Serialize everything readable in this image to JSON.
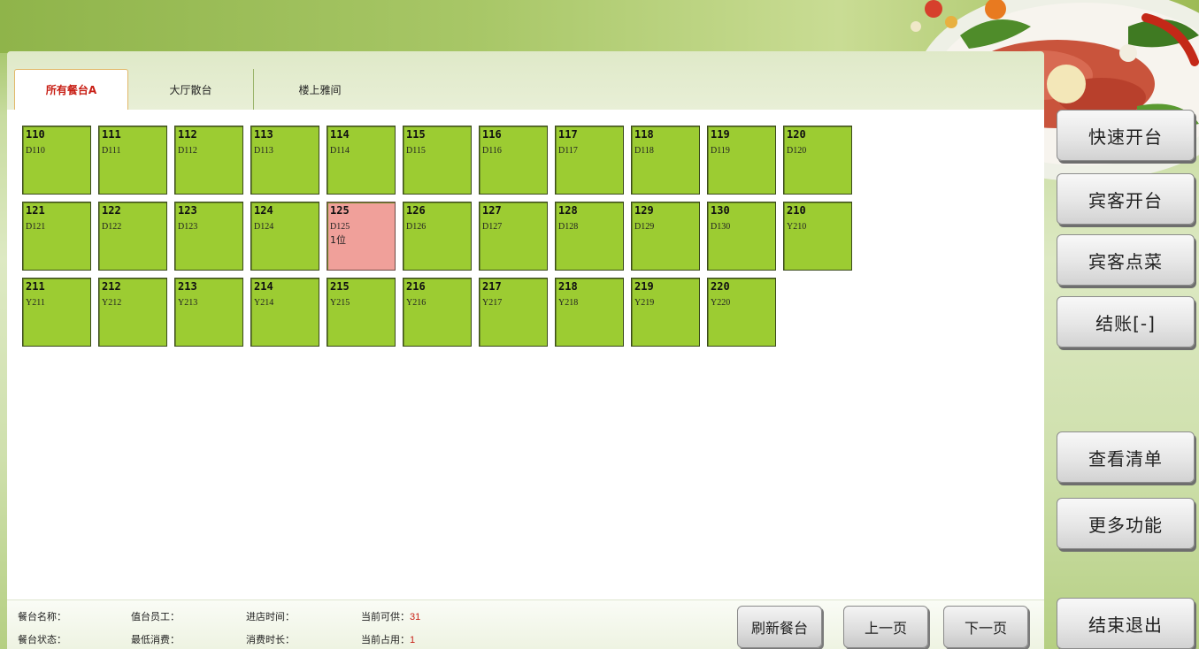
{
  "tabs": [
    {
      "label": "所有餐台A"
    },
    {
      "label": "大厅散台"
    },
    {
      "label": "楼上雅间"
    }
  ],
  "tables": [
    {
      "num": "110",
      "code": "D110",
      "guests": "",
      "status": "free"
    },
    {
      "num": "111",
      "code": "D111",
      "guests": "",
      "status": "free"
    },
    {
      "num": "112",
      "code": "D112",
      "guests": "",
      "status": "free"
    },
    {
      "num": "113",
      "code": "D113",
      "guests": "",
      "status": "free"
    },
    {
      "num": "114",
      "code": "D114",
      "guests": "",
      "status": "free"
    },
    {
      "num": "115",
      "code": "D115",
      "guests": "",
      "status": "free"
    },
    {
      "num": "116",
      "code": "D116",
      "guests": "",
      "status": "free"
    },
    {
      "num": "117",
      "code": "D117",
      "guests": "",
      "status": "free"
    },
    {
      "num": "118",
      "code": "D118",
      "guests": "",
      "status": "free"
    },
    {
      "num": "119",
      "code": "D119",
      "guests": "",
      "status": "free"
    },
    {
      "num": "120",
      "code": "D120",
      "guests": "",
      "status": "free"
    },
    {
      "num": "121",
      "code": "D121",
      "guests": "",
      "status": "free"
    },
    {
      "num": "122",
      "code": "D122",
      "guests": "",
      "status": "free"
    },
    {
      "num": "123",
      "code": "D123",
      "guests": "",
      "status": "free"
    },
    {
      "num": "124",
      "code": "D124",
      "guests": "",
      "status": "free"
    },
    {
      "num": "125",
      "code": "D125",
      "guests": "1位",
      "status": "occupied"
    },
    {
      "num": "126",
      "code": "D126",
      "guests": "",
      "status": "free"
    },
    {
      "num": "127",
      "code": "D127",
      "guests": "",
      "status": "free"
    },
    {
      "num": "128",
      "code": "D128",
      "guests": "",
      "status": "free"
    },
    {
      "num": "129",
      "code": "D129",
      "guests": "",
      "status": "free"
    },
    {
      "num": "130",
      "code": "D130",
      "guests": "",
      "status": "free"
    },
    {
      "num": "210",
      "code": "Y210",
      "guests": "",
      "status": "free"
    },
    {
      "num": "211",
      "code": "Y211",
      "guests": "",
      "status": "free"
    },
    {
      "num": "212",
      "code": "Y212",
      "guests": "",
      "status": "free"
    },
    {
      "num": "213",
      "code": "Y213",
      "guests": "",
      "status": "free"
    },
    {
      "num": "214",
      "code": "Y214",
      "guests": "",
      "status": "free"
    },
    {
      "num": "215",
      "code": "Y215",
      "guests": "",
      "status": "free"
    },
    {
      "num": "216",
      "code": "Y216",
      "guests": "",
      "status": "free"
    },
    {
      "num": "217",
      "code": "Y217",
      "guests": "",
      "status": "free"
    },
    {
      "num": "218",
      "code": "Y218",
      "guests": "",
      "status": "free"
    },
    {
      "num": "219",
      "code": "Y219",
      "guests": "",
      "status": "free"
    },
    {
      "num": "220",
      "code": "Y220",
      "guests": "",
      "status": "free"
    }
  ],
  "status_bar": {
    "table_name_label": "餐台名称：",
    "table_status_label": "餐台状态：",
    "staff_label": "值台员工：",
    "min_spend_label": "最低消费：",
    "checkin_label": "进店时间：",
    "duration_label": "消费时长：",
    "available_label": "当前可供：",
    "available_value": "31",
    "occupied_label": "当前占用：",
    "occupied_value": "1"
  },
  "bottom_buttons": {
    "refresh": "刷新餐台",
    "prev": "上一页",
    "next": "下一页"
  },
  "side_buttons": {
    "quick_open": "快速开台",
    "guest_open": "宾客开台",
    "guest_order": "宾客点菜",
    "checkout": "结账[-]",
    "view_list": "查看清单",
    "more": "更多功能",
    "exit": "结束退出"
  },
  "colors": {
    "free_tile": "#9ccc32",
    "occupied_tile": "#f0a09a",
    "accent_red": "#c81e14"
  }
}
